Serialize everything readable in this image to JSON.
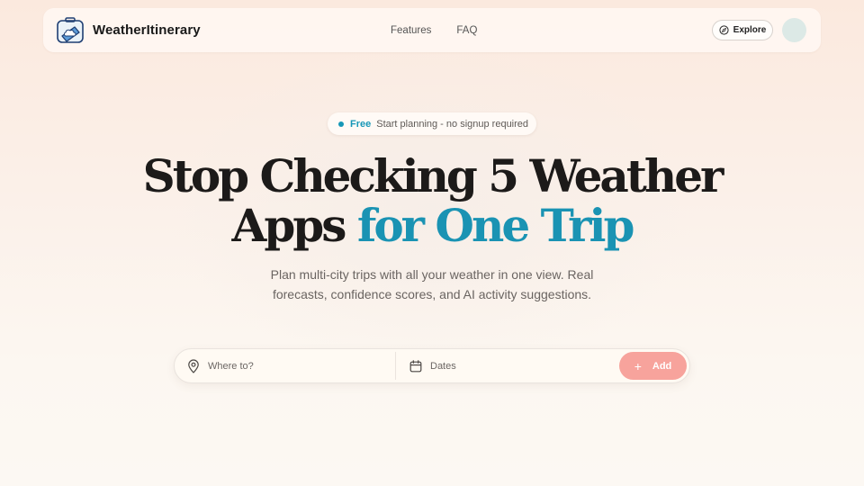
{
  "nav": {
    "brand": "WeatherItinerary",
    "brand_icon": "suitcase-cloud-logo",
    "links": [
      {
        "label": "Features"
      },
      {
        "label": "FAQ"
      }
    ],
    "explore_label": "Explore",
    "explore_icon": "compass-icon"
  },
  "badge": {
    "highlight": "Free",
    "text": "Start planning - no signup required"
  },
  "hero": {
    "title_line1": "Stop Checking 5 Weather",
    "title_line2_plain": "Apps ",
    "title_line2_accent": "for One Trip",
    "subtitle_line1": "Plan multi-city trips with all your weather in one view. Real",
    "subtitle_line2": "forecasts, confidence scores, and AI activity suggestions."
  },
  "search": {
    "where_placeholder": "Where to?",
    "dates_placeholder": "Dates",
    "add_label": "Add",
    "add_symbol": "+"
  },
  "colors": {
    "accent": "#1a93b3",
    "badge_accent": "#1697b7",
    "add_button": "#f7a39c",
    "avatar": "#dce9e6"
  }
}
